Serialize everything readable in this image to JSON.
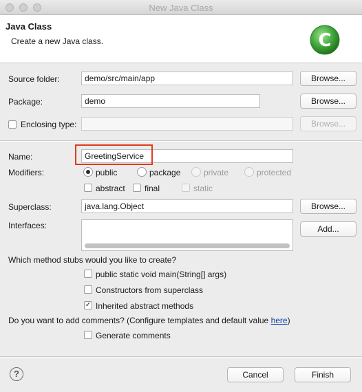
{
  "window": {
    "title": "New Java Class"
  },
  "banner": {
    "title": "Java Class",
    "subtitle": "Create a new Java class.",
    "logo_letter": "C",
    "logo_icon": "java-class-wizard-icon"
  },
  "source_folder": {
    "label": "Source folder:",
    "value": "demo/src/main/app",
    "browse": "Browse..."
  },
  "package": {
    "label": "Package:",
    "value": "demo",
    "browse": "Browse..."
  },
  "enclosing": {
    "label": "Enclosing type:",
    "value": "",
    "browse": "Browse..."
  },
  "name": {
    "label": "Name:",
    "value": "GreetingService"
  },
  "modifiers": {
    "label": "Modifiers:",
    "public": "public",
    "package": "package",
    "private": "private",
    "protected": "protected",
    "abstract": "abstract",
    "final": "final",
    "static": "static"
  },
  "superclass": {
    "label": "Superclass:",
    "value": "java.lang.Object",
    "browse": "Browse..."
  },
  "interfaces": {
    "label": "Interfaces:",
    "add": "Add..."
  },
  "stubs": {
    "question": "Which method stubs would you like to create?",
    "main": "public static void main(String[] args)",
    "constructors": "Constructors from superclass",
    "inherited": "Inherited abstract methods"
  },
  "comments": {
    "question": "Do you want to add comments? (Configure templates and default value ",
    "link": "here",
    "close": ")",
    "generate": "Generate comments"
  },
  "footer": {
    "help": "?",
    "cancel": "Cancel",
    "finish": "Finish"
  },
  "colors": {
    "highlight": "#e03a1c",
    "logo": "#3fa63a"
  }
}
